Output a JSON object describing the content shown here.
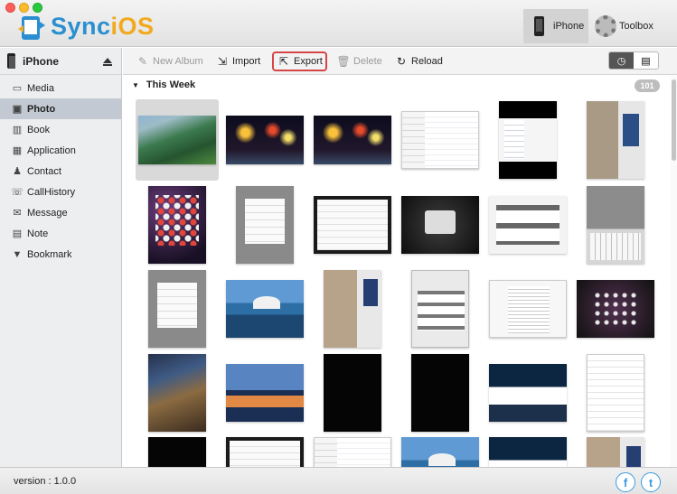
{
  "app": {
    "name_left": "Sync",
    "name_right": "iOS",
    "brand_blue": "#2a8fd0",
    "brand_orange": "#f2a91e"
  },
  "top_tabs": [
    {
      "label": "iPhone",
      "icon": "iphone-icon",
      "selected": true
    },
    {
      "label": "Toolbox",
      "icon": "gear-icon",
      "selected": false
    }
  ],
  "sidebar": {
    "device": "iPhone",
    "items": [
      {
        "label": "Media",
        "icon": "tv-icon",
        "glyph": "▭"
      },
      {
        "label": "Photo",
        "icon": "photo-icon",
        "glyph": "▣",
        "active": true
      },
      {
        "label": "Book",
        "icon": "book-icon",
        "glyph": "▥"
      },
      {
        "label": "Application",
        "icon": "app-grid-icon",
        "glyph": "▦"
      },
      {
        "label": "Contact",
        "icon": "contact-icon",
        "glyph": "♟"
      },
      {
        "label": "CallHistory",
        "icon": "phone-call-icon",
        "glyph": "☏"
      },
      {
        "label": "Message",
        "icon": "message-icon",
        "glyph": "✉"
      },
      {
        "label": "Note",
        "icon": "note-icon",
        "glyph": "▤"
      },
      {
        "label": "Bookmark",
        "icon": "bookmark-icon",
        "glyph": "▼"
      }
    ]
  },
  "toolbar": {
    "new_album": "New Album",
    "import": "Import",
    "export": "Export",
    "delete": "Delete",
    "reload": "Reload",
    "view_modes": [
      "clock-icon",
      "list-icon"
    ]
  },
  "content": {
    "section_title": "This Week",
    "count": "101",
    "thumbnails": [
      {
        "row": 0,
        "col": 0,
        "kind": "landscape-green",
        "selected": true
      },
      {
        "row": 0,
        "col": 1,
        "kind": "fireworks"
      },
      {
        "row": 0,
        "col": 2,
        "kind": "fireworks"
      },
      {
        "row": 0,
        "col": 3,
        "kind": "screen-white"
      },
      {
        "row": 0,
        "col": 4,
        "kind": "portrait-screen"
      },
      {
        "row": 0,
        "col": 5,
        "kind": "photo-wall"
      },
      {
        "row": 1,
        "col": 0,
        "kind": "ipad-home"
      },
      {
        "row": 1,
        "col": 1,
        "kind": "grey-settings"
      },
      {
        "row": 1,
        "col": 2,
        "kind": "dark-settings"
      },
      {
        "row": 1,
        "col": 3,
        "kind": "dark-popup"
      },
      {
        "row": 1,
        "col": 4,
        "kind": "cards"
      },
      {
        "row": 1,
        "col": 5,
        "kind": "keyboard"
      },
      {
        "row": 2,
        "col": 0,
        "kind": "grey-settings"
      },
      {
        "row": 2,
        "col": 1,
        "kind": "harbor"
      },
      {
        "row": 2,
        "col": 2,
        "kind": "wall-portrait"
      },
      {
        "row": 2,
        "col": 3,
        "kind": "ipad-grid"
      },
      {
        "row": 2,
        "col": 4,
        "kind": "document"
      },
      {
        "row": 2,
        "col": 5,
        "kind": "dark-ipad"
      },
      {
        "row": 3,
        "col": 0,
        "kind": "canyon"
      },
      {
        "row": 3,
        "col": 1,
        "kind": "lake"
      },
      {
        "row": 3,
        "col": 2,
        "kind": "black-tile"
      },
      {
        "row": 3,
        "col": 3,
        "kind": "black-tile"
      },
      {
        "row": 3,
        "col": 4,
        "kind": "clouds"
      },
      {
        "row": 3,
        "col": 5,
        "kind": "settings-list"
      }
    ]
  },
  "status": {
    "version": "version :  1.0.0",
    "social": [
      {
        "name": "facebook-icon",
        "glyph": "f"
      },
      {
        "name": "twitter-icon",
        "glyph": "t"
      }
    ]
  }
}
